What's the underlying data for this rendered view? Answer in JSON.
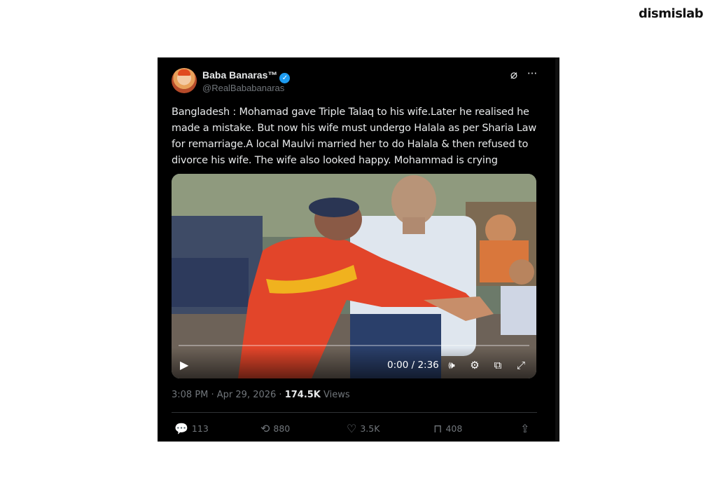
{
  "brand": {
    "logo_text": "dismislab"
  },
  "tweet": {
    "author_name": "Baba Banaras™",
    "verified_mark": "✓",
    "handle": "@RealBababanaras",
    "text": "Bangladesh : Mohamad gave Triple Talaq to his wife.Later he realised he made a mistake. But now his wife must undergo Halala as per Sharia Law for remarriage.A local Maulvi married her to do Halala & then refused to divorce his wife. The wife also looked happy. Mohammad is crying",
    "video": {
      "time": "0:00 / 2:36",
      "icons": [
        "play-icon",
        "volume-icon",
        "settings-icon",
        "pip-icon",
        "fullscreen-icon"
      ]
    },
    "timestamp": "3:08 PM · Apr 29, 2026 · ",
    "views_count": "174.5K",
    "views_label": " Views",
    "actions": {
      "replies": "113",
      "reposts": "880",
      "likes": "3.5K",
      "bookmarks": "408"
    }
  },
  "colors": {
    "background": "#000000",
    "text": "#e7e9ea",
    "muted": "#71767b",
    "verified": "#1d9bf0"
  }
}
